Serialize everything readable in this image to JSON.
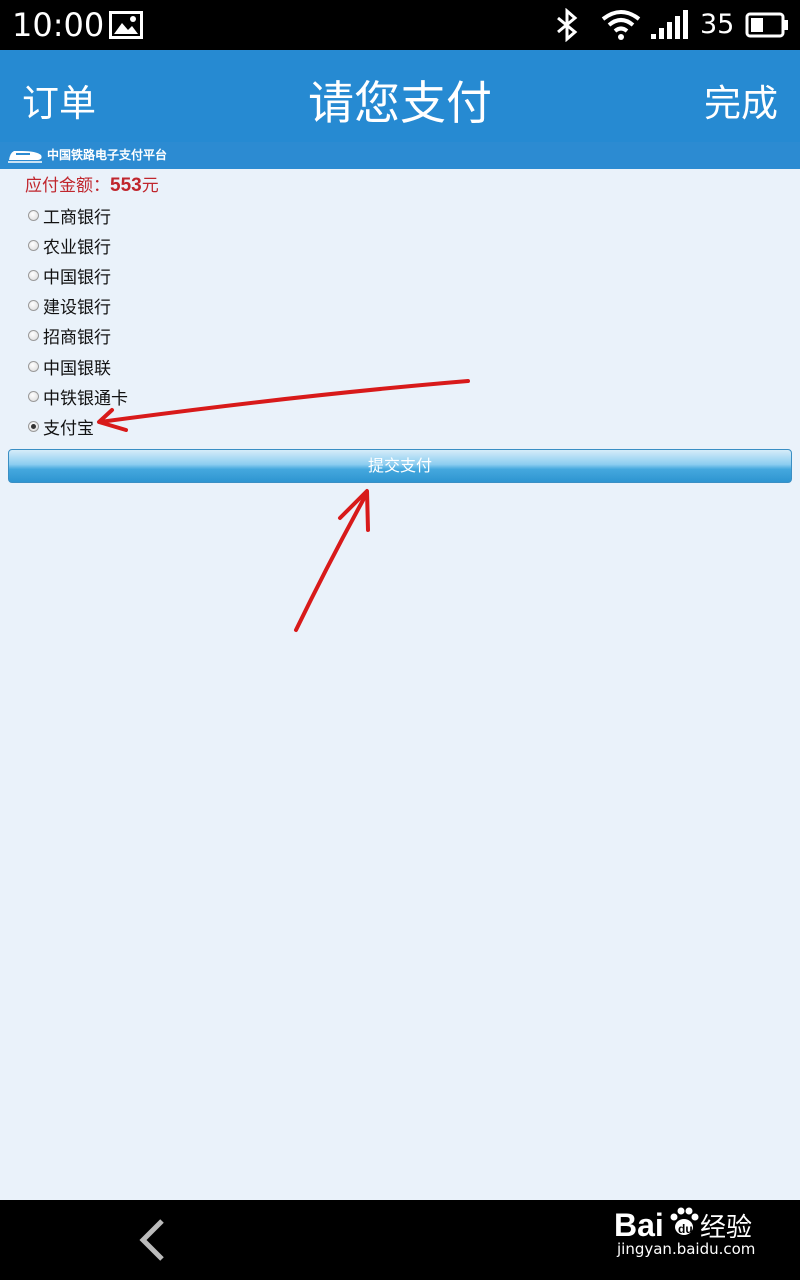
{
  "status_bar": {
    "time": "10:00",
    "battery_percent": "35",
    "icons": [
      "image-icon",
      "bluetooth-icon",
      "wifi-icon",
      "signal-icon",
      "battery-icon"
    ]
  },
  "header": {
    "left_label": "订单",
    "title": "请您支付",
    "right_label": "完成",
    "background_color": "#268ad2"
  },
  "platform": {
    "name": "中国铁路电子支付平台"
  },
  "payment": {
    "amount_label": "应付金额：",
    "amount_value": "553",
    "amount_unit": "元",
    "amount_color": "#c0262d",
    "banks": [
      {
        "label": "工商银行",
        "selected": false
      },
      {
        "label": "农业银行",
        "selected": false
      },
      {
        "label": "中国银行",
        "selected": false
      },
      {
        "label": "建设银行",
        "selected": false
      },
      {
        "label": "招商银行",
        "selected": false
      },
      {
        "label": "中国银联",
        "selected": false
      },
      {
        "label": "中铁银通卡",
        "selected": false
      },
      {
        "label": "支付宝",
        "selected": true
      }
    ],
    "submit_label": "提交支付"
  },
  "nav_bar": {
    "back_icon": "chevron-left-icon"
  },
  "watermark": {
    "logo_text": "Bai du 经验",
    "url": "jingyan.baidu.com"
  },
  "annotations": {
    "arrow_color": "#d81a1a"
  }
}
